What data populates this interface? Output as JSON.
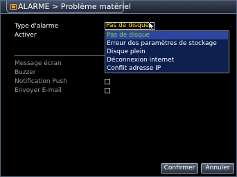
{
  "window": {
    "title": "ALARME > Problème matériel",
    "title_icon": "folder-icon"
  },
  "form": {
    "alarm_type_label": "Type d'alarme",
    "alarm_type_value": "Pas de disque",
    "enable_label": "Activer",
    "screen_message_label": "Message écran",
    "buzzer_label": "Buzzer",
    "push_label": "Notification Push",
    "email_label": "Envoyer E-mail"
  },
  "dropdown": {
    "options": [
      "Pas de disque",
      "Erreur des paramètres de stockage",
      "Disque plein",
      "Déconnexion internet",
      "Conflit adresse IP"
    ],
    "selected_index": 0
  },
  "checkboxes": {
    "push_checked": false,
    "email_checked": false
  },
  "buttons": {
    "confirm": "Confirmer",
    "cancel": "Annuler"
  },
  "colors": {
    "selected_value": "#ffeb00",
    "dropdown_bg": "#0d2050",
    "highlight_bg": "#2b47a0",
    "highlight_text": "#9acd32"
  }
}
